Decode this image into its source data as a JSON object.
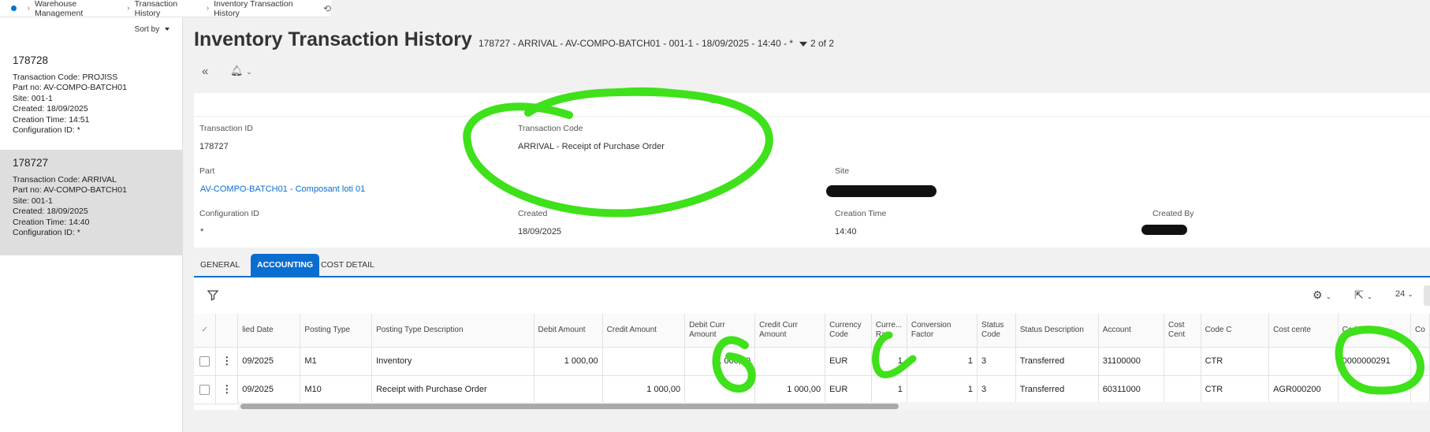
{
  "breadcrumb": [
    "Warehouse Management",
    "Transaction History",
    "Inventory Transaction History"
  ],
  "sort_by": "Sort by",
  "list": [
    {
      "id": "178728",
      "transaction_code": "Transaction Code:   PROJISS",
      "part_no": "Part no:   AV-COMPO-BATCH01",
      "site": "Site:   001-1",
      "created": "Created:   18/09/2025",
      "creation_time": "Creation Time:   14:51",
      "configuration_id": "Configuration ID:   *"
    },
    {
      "id": "178727",
      "transaction_code": "Transaction Code:   ARRIVAL",
      "part_no": "Part no:   AV-COMPO-BATCH01",
      "site": "Site:   001-1",
      "created": "Created:   18/09/2025",
      "creation_time": "Creation Time:   14:40",
      "configuration_id": "Configuration ID:   *"
    }
  ],
  "header": {
    "title": "Inventory Transaction History",
    "record_selector": "178727 - ARRIVAL - AV-COMPO-BATCH01 - 001-1 - 18/09/2025 - 14:40 - *",
    "record_count": "2 of 2"
  },
  "detail": {
    "transaction_id_label": "Transaction ID",
    "transaction_id": "178727",
    "transaction_code_label": "Transaction Code",
    "transaction_code": "ARRIVAL - Receipt of Purchase Order",
    "part_label": "Part",
    "part": "AV-COMPO-BATCH01 - Composant loti 01",
    "site_label": "Site",
    "configuration_id_label": "Configuration ID",
    "configuration_id": "*",
    "created_label": "Created",
    "created": "18/09/2025",
    "creation_time_label": "Creation Time",
    "creation_time": "14:40",
    "created_by_label": "Created By"
  },
  "tabs": [
    "GENERAL",
    "ACCOUNTING",
    "COST DETAIL"
  ],
  "toolbar": {
    "page_size": "24"
  },
  "grid": {
    "columns": [
      "lied Date",
      "Posting Type",
      "Posting Type Description",
      "Debit Amount",
      "Credit Amount",
      "Debit Curr Amount",
      "Credit Curr Amount",
      "Currency Code",
      "Curre... Rate",
      "Conversion Factor",
      "Status Code",
      "Status Description",
      "Account",
      "Cost Cent",
      "Code C",
      "Cost cente",
      "Code E",
      "Co"
    ],
    "rows": [
      [
        "09/2025",
        "M1",
        "Inventory",
        "1 000,00",
        "",
        "1 000,00",
        "",
        "EUR",
        "1",
        "1",
        "3",
        "Transferred",
        "31100000",
        "",
        "CTR",
        "",
        "0000000291",
        ""
      ],
      [
        "09/2025",
        "M10",
        "Receipt with Purchase Order",
        "",
        "1 000,00",
        "",
        "1 000,00",
        "EUR",
        "1",
        "1",
        "3",
        "Transferred",
        "60311000",
        "",
        "CTR",
        "AGR000200",
        "",
        ""
      ]
    ]
  },
  "colors": {
    "accent": "#0a6ed1",
    "scribble": "#3ee11a"
  }
}
